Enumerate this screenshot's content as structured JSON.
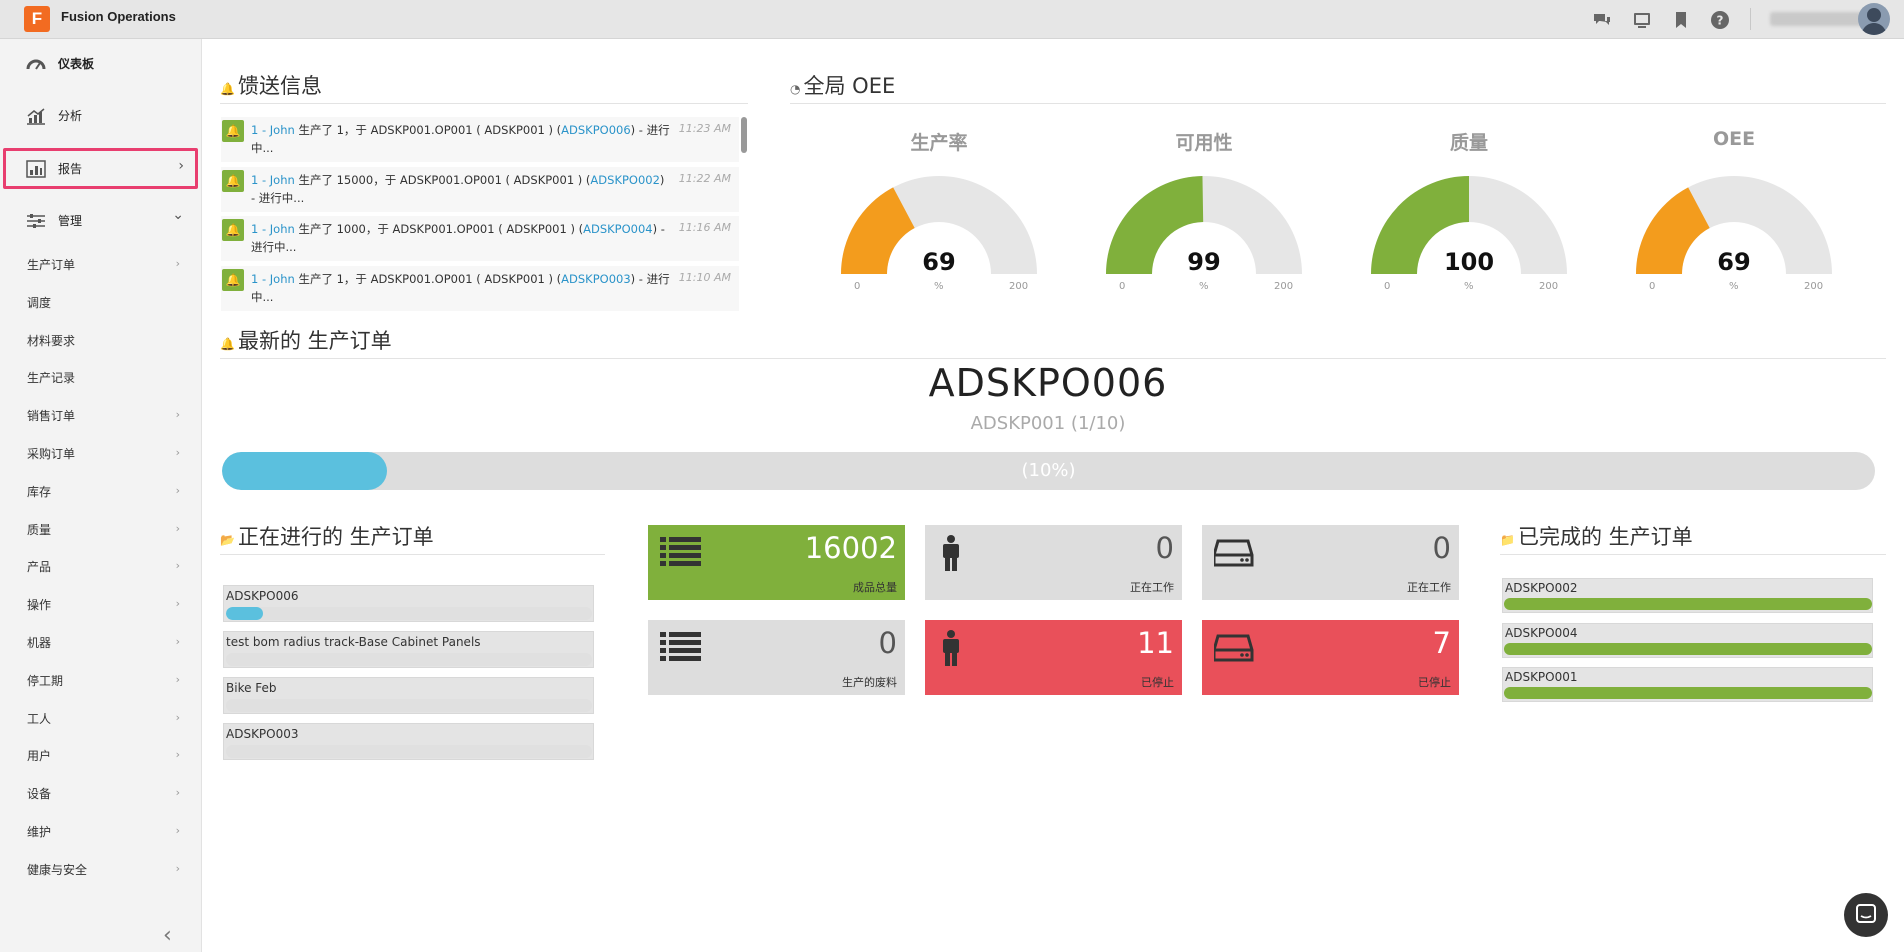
{
  "app": {
    "title": "Fusion Operations",
    "logo_letter": "F"
  },
  "sidebar": {
    "main_items": [
      {
        "label": "仪表板",
        "icon": "dashboard-gauge-icon"
      },
      {
        "label": "分析",
        "icon": "bar-chart-icon"
      },
      {
        "label": "报告",
        "icon": "report-chart-icon",
        "chevron": "›"
      },
      {
        "label": "管理",
        "icon": "sliders-icon",
        "chevron": "⌄"
      }
    ],
    "sub_items": [
      "生产订单",
      "调度",
      "材料要求",
      "生产记录",
      "销售订单",
      "采购订单",
      "库存",
      "质量",
      "产品",
      "操作",
      "机器",
      "停工期",
      "工人",
      "用户",
      "设备",
      "维护",
      "健康与安全"
    ],
    "sub_chevron": "›",
    "collapse_glyph": "‹"
  },
  "feed": {
    "heading": "馈送信息",
    "items": [
      {
        "user": "1 - John",
        "pre": " 生产了 1，于 ADSKP001.OP001 ( ADSKP001 ) (",
        "po": "ADSKPO006",
        "post": ") - 进行中...",
        "time": "11:23 AM"
      },
      {
        "user": "1 - John",
        "pre": " 生产了 15000，于 ADSKP001.OP001 ( ADSKP001 ) (",
        "po": "ADSKPO002",
        "post": ") - 进行中...",
        "time": "11:22 AM"
      },
      {
        "user": "1 - John",
        "pre": " 生产了 1000，于 ADSKP001.OP001 ( ADSKP001 ) (",
        "po": "ADSKPO004",
        "post": ") - 进行中...",
        "time": "11:16 AM"
      },
      {
        "user": "1 - John",
        "pre": " 生产了 1，于 ADSKP001.OP001 ( ADSKP001 ) (",
        "po": "ADSKPO003",
        "post": ") - 进行中...",
        "time": "11:10 AM"
      }
    ]
  },
  "oee": {
    "heading": "全局 OEE",
    "gauges": [
      {
        "title": "生产率",
        "value": 69,
        "unit": "%",
        "min": "0",
        "max": "200",
        "color": "#f39c1d"
      },
      {
        "title": "可用性",
        "value": 99,
        "unit": "%",
        "min": "0",
        "max": "200",
        "color": "#80b03c"
      },
      {
        "title": "质量",
        "value": 100,
        "unit": "%",
        "min": "0",
        "max": "200",
        "color": "#80b03c"
      },
      {
        "title": "OEE",
        "value": 69,
        "unit": "%",
        "min": "0",
        "max": "200",
        "color": "#f39c1d"
      }
    ]
  },
  "latest": {
    "heading": "最新的 生产订单",
    "po": "ADSKPO006",
    "product": "ADSKP001 (1/10)",
    "progress": 0.1,
    "progress_label": "(10%)"
  },
  "in_progress": {
    "heading": "正在进行的 生产订单",
    "items": [
      {
        "label": "ADSKPO006",
        "progress": 0.1
      },
      {
        "label": "test bom radius track-Base Cabinet Panels",
        "progress": 0
      },
      {
        "label": "Bike Feb",
        "progress": 0
      },
      {
        "label": "ADSKPO003",
        "progress": 0
      }
    ]
  },
  "tiles": [
    {
      "value": "16002",
      "caption": "成品总量",
      "icon": "list-icon",
      "style": "green"
    },
    {
      "value": "0",
      "caption": "正在工作",
      "icon": "worker-icon",
      "style": "grey"
    },
    {
      "value": "0",
      "caption": "正在工作",
      "icon": "machine-drive-icon",
      "style": "grey"
    },
    {
      "value": "0",
      "caption": "生产的废料",
      "icon": "list-icon",
      "style": "grey"
    },
    {
      "value": "11",
      "caption": "已停止",
      "icon": "worker-icon",
      "style": "red"
    },
    {
      "value": "7",
      "caption": "已停止",
      "icon": "machine-drive-icon",
      "style": "red"
    }
  ],
  "completed": {
    "heading": "已完成的 生产订单",
    "items": [
      {
        "label": "ADSKPO002",
        "progress": 1
      },
      {
        "label": "ADSKPO004",
        "progress": 1
      },
      {
        "label": "ADSKPO001",
        "progress": 1
      }
    ]
  },
  "colors": {
    "accent_blue": "#5bc0de",
    "green": "#80b03c",
    "orange": "#f39c1d",
    "red": "#e9505a",
    "highlight_pink": "#e83e6f"
  }
}
